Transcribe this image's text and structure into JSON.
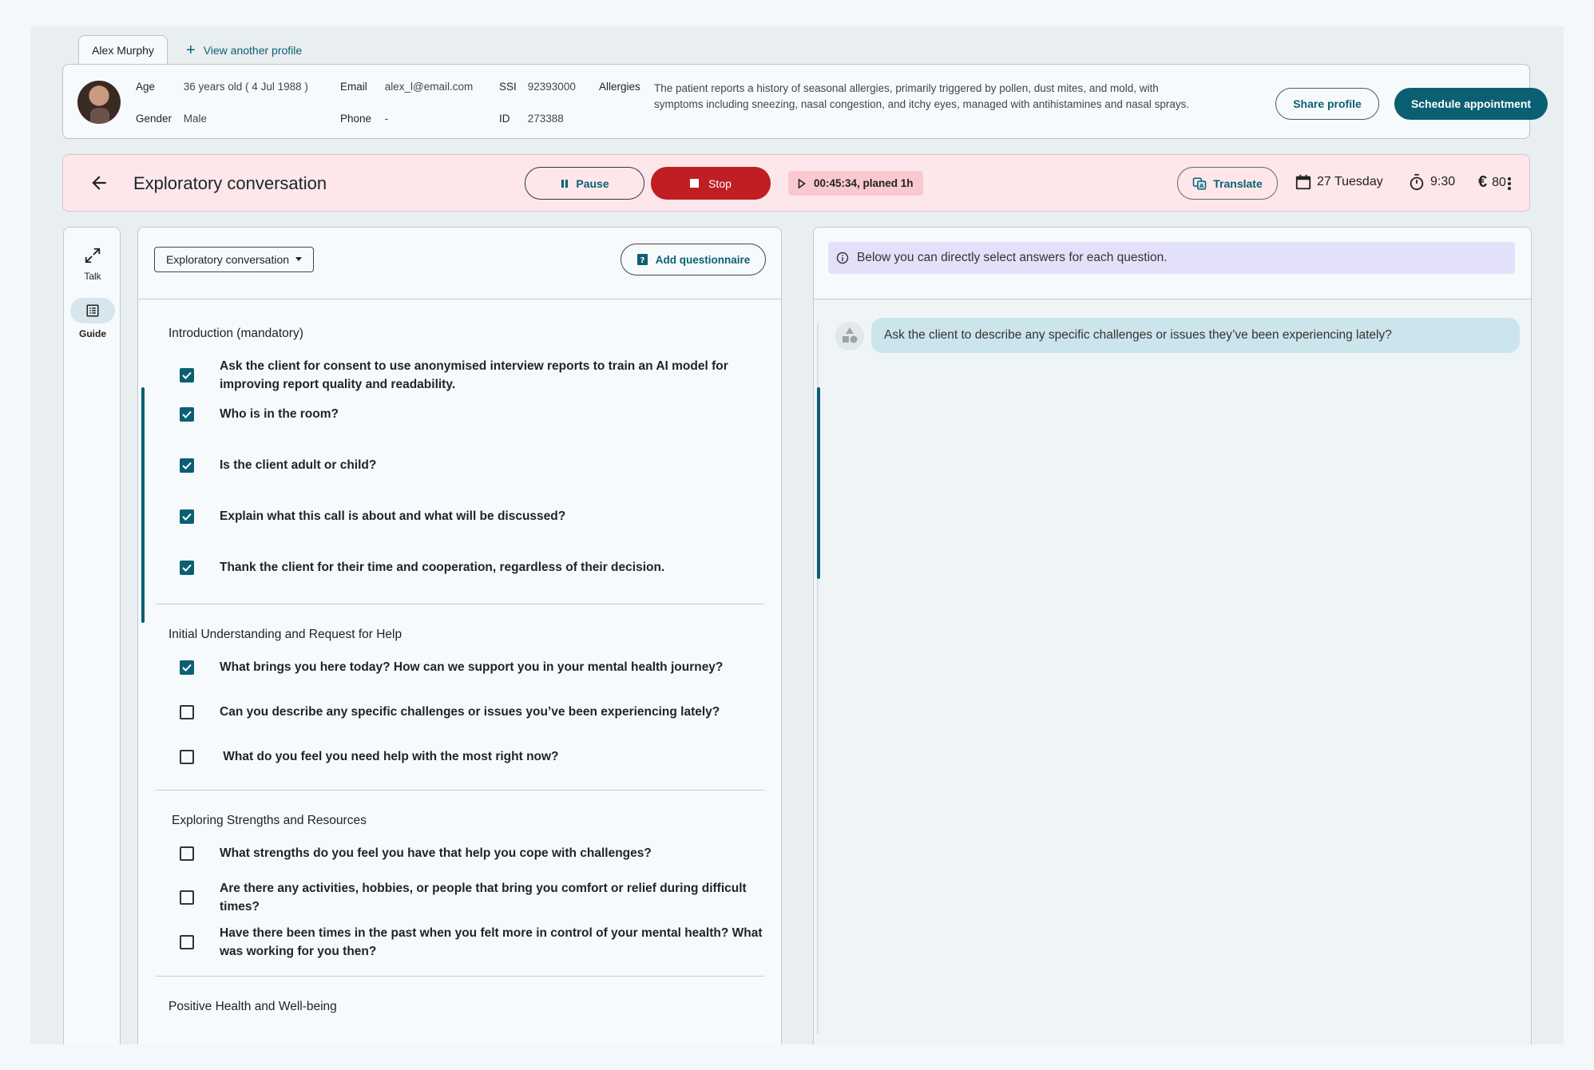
{
  "profile_tabs": {
    "active": "Alex Murphy",
    "add_label": "View another profile"
  },
  "profile": {
    "age_label": "Age",
    "age_value": "36 years old ( 4 Jul 1988 )",
    "gender_label": "Gender",
    "gender_value": "Male",
    "email_label": "Email",
    "email_value": "alex_l@email.com",
    "phone_label": "Phone",
    "phone_value": "-",
    "ssi_label": "SSI",
    "ssi_value": "92393000",
    "id_label": "ID",
    "id_value": "273388",
    "allergies_label": "Allergies",
    "allergies_value": "The patient reports a history of seasonal allergies, primarily triggered by pollen, dust mites, and mold, with symptoms including sneezing, nasal congestion, and itchy eyes, managed with antihistamines and nasal sprays.",
    "share_label": "Share profile",
    "schedule_label": "Schedule appointment"
  },
  "session": {
    "title": "Exploratory conversation",
    "pause_label": "Pause",
    "stop_label": "Stop",
    "timer": "00:45:34, planed 1h",
    "translate_label": "Translate",
    "date": "27 Tuesday",
    "time": "9:30",
    "price": "80"
  },
  "rail": {
    "talk_label": "Talk",
    "guide_label": "Guide"
  },
  "guide": {
    "selector_label": "Exploratory conversation",
    "add_questionnaire_label": "Add questionnaire",
    "sections": [
      {
        "title": "Introduction (mandatory)",
        "questions": [
          {
            "text": "Ask the client for consent to use anonymised interview reports to train an AI model for improving report quality and readability.",
            "checked": true
          },
          {
            "text": "Who is in the room?",
            "checked": true
          },
          {
            "text": "Is the client adult or child?",
            "checked": true
          },
          {
            "text": "Explain what this call is about and what will be discussed?",
            "checked": true
          },
          {
            "text": "Thank the client for their time and cooperation, regardless of their decision.",
            "checked": true
          }
        ]
      },
      {
        "title": "Initial Understanding and Request for Help",
        "questions": [
          {
            "text": "What brings you here today? How can we support you in your mental health journey?",
            "checked": true
          },
          {
            "text": "Can you describe any specific challenges or issues you’ve been experiencing lately?",
            "checked": false
          },
          {
            "text": " What do you feel you need help with the most right now?",
            "checked": false
          }
        ]
      },
      {
        "title": "Exploring Strengths and Resources",
        "questions": [
          {
            "text": "What strengths do you feel you have that help you cope with challenges?",
            "checked": false
          },
          {
            "text": "Are there any activities, hobbies, or people that bring you comfort or relief during difficult times?",
            "checked": false
          },
          {
            "text": "Have there been times in the past when you felt more in control of your mental health? What was working for you then?",
            "checked": false
          }
        ]
      },
      {
        "title": "Positive Health and Well-being",
        "questions": []
      }
    ]
  },
  "chat": {
    "info": "Below you can directly select answers for each question.",
    "message": "Ask the client to describe any specific challenges or issues they’ve been experiencing lately?"
  },
  "colors": {
    "primary": "#0b5f73",
    "stop": "#bf1e22",
    "session_bg": "#fde7ea",
    "info_bg": "#e3e0fa",
    "bubble_bg": "#cce4ec"
  }
}
